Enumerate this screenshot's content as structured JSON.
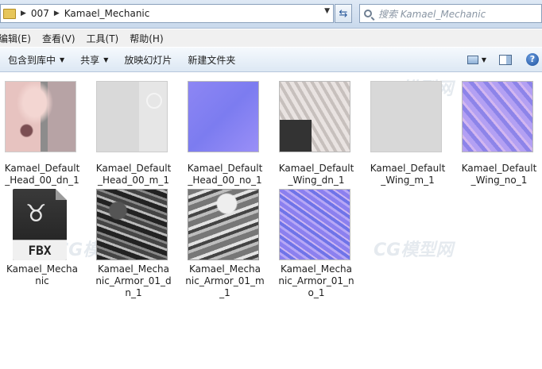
{
  "address": {
    "crumbs": [
      "007",
      "Kamael_Mechanic"
    ]
  },
  "search": {
    "placeholder": "搜索 Kamael_Mechanic"
  },
  "menu": [
    "编辑(E)",
    "查看(V)",
    "工具(T)",
    "帮助(H)"
  ],
  "toolbar": {
    "include_library": "包含到库中",
    "share": "共享",
    "slideshow": "放映幻灯片",
    "new_folder": "新建文件夹"
  },
  "files": [
    {
      "name": "Kamael_Default_Head_00_dn_1",
      "line1": "Kamael_Default",
      "line2": "_Head_00_dn_1",
      "line3": ""
    },
    {
      "name": "Kamael_Default_Head_00_m_1",
      "line1": "Kamael_Default",
      "line2": "_Head_00_m_1",
      "line3": ""
    },
    {
      "name": "Kamael_Default_Head_00_no_1",
      "line1": "Kamael_Default",
      "line2": "_Head_00_no_1",
      "line3": ""
    },
    {
      "name": "Kamael_Default_Wing_dn_1",
      "line1": "Kamael_Default",
      "line2": "_Wing_dn_1",
      "line3": ""
    },
    {
      "name": "Kamael_Default_Wing_m_1",
      "line1": "Kamael_Default",
      "line2": "_Wing_m_1",
      "line3": ""
    },
    {
      "name": "Kamael_Default_Wing_no_1",
      "line1": "Kamael_Default",
      "line2": "_Wing_no_1",
      "line3": ""
    },
    {
      "name": "Kamael_Mechanic",
      "line1": "Kamael_Mecha",
      "line2": "nic",
      "line3": "",
      "icon_label": "FBX"
    },
    {
      "name": "Kamael_Mechanic_Armor_01_dn_1",
      "line1": "Kamael_Mecha",
      "line2": "nic_Armor_01_d",
      "line3": "n_1"
    },
    {
      "name": "Kamael_Mechanic_Armor_01_m_1",
      "line1": "Kamael_Mecha",
      "line2": "nic_Armor_01_m",
      "line3": "_1"
    },
    {
      "name": "Kamael_Mechanic_Armor_01_no_1",
      "line1": "Kamael_Mecha",
      "line2": "nic_Armor_01_n",
      "line3": "o_1"
    }
  ],
  "watermark": "CG模型网"
}
